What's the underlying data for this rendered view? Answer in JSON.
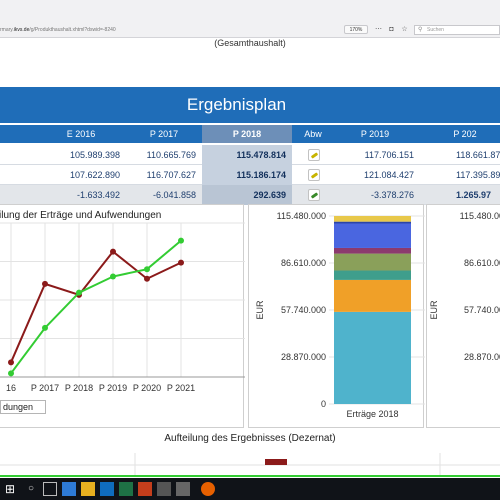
{
  "browser": {
    "url_prefix": "rmary.",
    "url_host": "ikvs.de",
    "url_path": "/g/Produkthaushalt.xhtml?dswid=-8240",
    "zoom": "170%",
    "search_placeholder": "Suchen"
  },
  "header": {
    "gesamthaushalt": "(Gesamthaushalt)",
    "title": "Ergebnisplan"
  },
  "table": {
    "columns": [
      "E 2016",
      "P 2017",
      "P 2018",
      "Abw",
      "P 2019",
      "P 202"
    ],
    "rows": [
      {
        "values": [
          "105.989.398",
          "110.665.769",
          "115.478.814",
          "117.706.151",
          "118.661.87"
        ],
        "abw_color": "#c8b400"
      },
      {
        "values": [
          "107.622.890",
          "116.707.627",
          "115.186.174",
          "121.084.427",
          "117.395.89"
        ],
        "abw_color": "#c8b400"
      },
      {
        "values": [
          "-1.633.492",
          "-6.041.858",
          "292.639",
          "-3.378.276",
          "1.265.97"
        ],
        "abw_color": "#3a8a2a"
      }
    ]
  },
  "line_panel": {
    "title": "ilung der Erträge und Aufwendungen",
    "legend_button": "dungen"
  },
  "stack_panel": {
    "ylabel": "EUR",
    "xlabel": "Erträge 2018"
  },
  "right_panel": {
    "ylabel": "EUR"
  },
  "bottom": {
    "title": "Aufteilung des Ergebnisses (Dezernat)"
  },
  "chart_data": [
    {
      "type": "line",
      "x": [
        "16",
        "P 2017",
        "P 2018",
        "P 2019",
        "P 2020",
        "P 2021"
      ],
      "series": [
        {
          "color": "#8b1a1a",
          "values": [
            106.0,
            116.7,
            115.2,
            121.1,
            117.4,
            119.6
          ]
        },
        {
          "color": "#33cc33",
          "values": [
            104.5,
            110.7,
            115.5,
            117.7,
            118.7,
            122.6
          ]
        }
      ],
      "ylim": [
        104.0,
        125.0
      ],
      "grid": true
    },
    {
      "type": "bar",
      "categories": [
        "Erträge 2018"
      ],
      "yticks": [
        "115.480.000",
        "86.610.000",
        "57.740.000",
        "28.870.000",
        "0"
      ],
      "ylim": [
        0,
        115480000
      ],
      "stack_fractions": [
        {
          "color": "#4fb3cc",
          "value": 0.49
        },
        {
          "color": "#f0a028",
          "value": 0.17
        },
        {
          "color": "#3f9e8c",
          "value": 0.05
        },
        {
          "color": "#8aa05a",
          "value": 0.09
        },
        {
          "color": "#8c3a6e",
          "value": 0.03
        },
        {
          "color": "#4a66e0",
          "value": 0.13
        },
        {
          "color": "#2b45a8",
          "value": 0.01
        },
        {
          "color": "#e8c84a",
          "value": 0.03
        }
      ]
    },
    {
      "type": "bar",
      "yticks": [
        "115.480.000",
        "86.610.000",
        "57.740.000",
        "28.870.000",
        "0"
      ]
    }
  ],
  "colors": {
    "primary_blue": "#1f6db8",
    "selected_header": "#6d8fb8",
    "selected_cell": "#c6d1df"
  }
}
